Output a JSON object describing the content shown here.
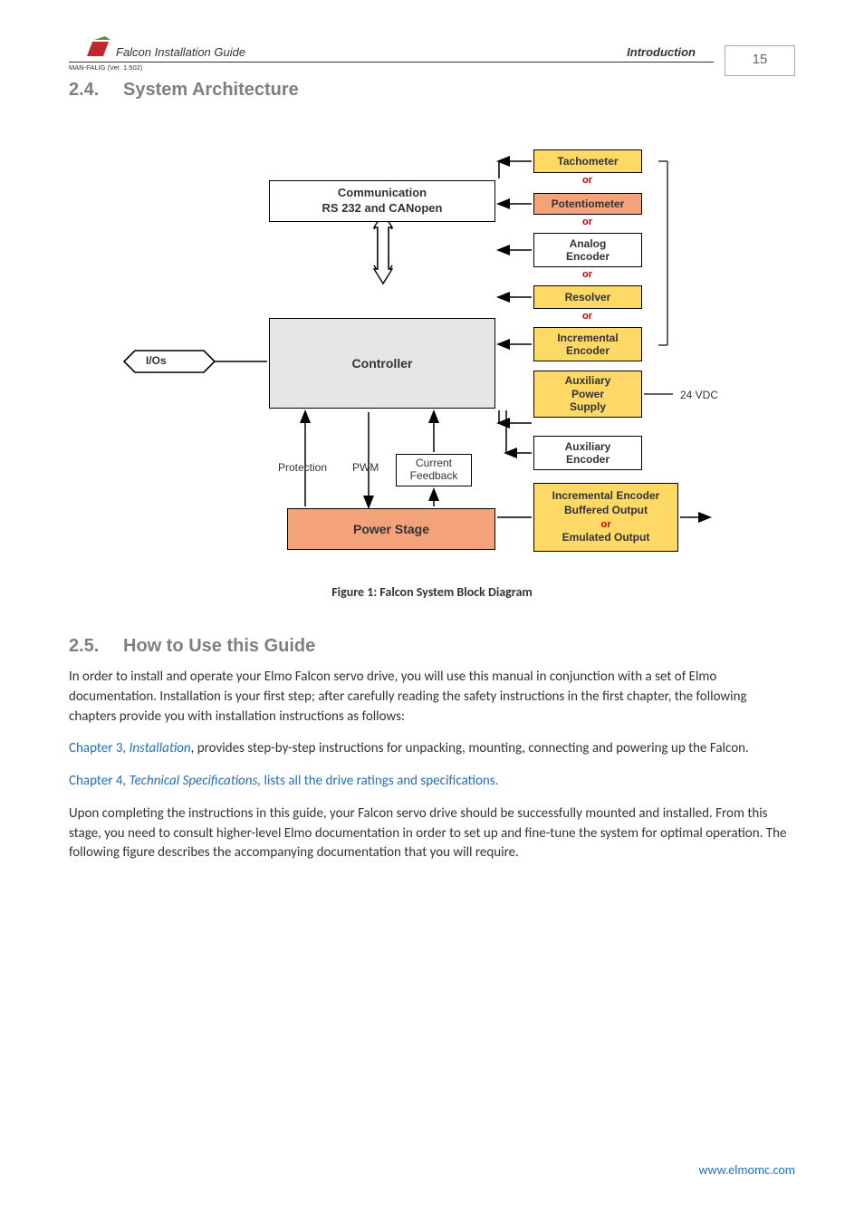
{
  "header": {
    "doc_title": "Falcon Installation Guide",
    "section_right": "Introduction",
    "version_line": "MAN-FALIG (Ver. 1.502)",
    "page_number": "15"
  },
  "section24": {
    "num": "2.4.",
    "title": "System Architecture"
  },
  "diagram": {
    "controller": "Controller",
    "power_stage": "Power Stage",
    "comm_l1": "Communication",
    "comm_l2": "RS 232 and CANopen",
    "ios": "I/Os",
    "current_l1": "Current",
    "current_l2": "Feedback",
    "protection": "Protection",
    "pwm": "PWM",
    "tacho": "Tachometer",
    "pot": "Potentiometer",
    "analog_l1": "Analog",
    "analog_l2": "Encoder",
    "resolver": "Resolver",
    "inc_l1": "Incremental",
    "inc_l2": "Encoder",
    "auxpw_l1": "Auxiliary",
    "auxpw_l2": "Power",
    "auxpw_l3": "Supply",
    "auxen_l1": "Auxiliary",
    "auxen_l2": "Encoder",
    "ibuf_l1": "Incremental Encoder",
    "ibuf_l2": "Buffered Output",
    "ibuf_or": "or",
    "ibuf_l3": "Emulated Output",
    "or": "or",
    "vdc": "24 VDC",
    "caption": "Figure 1: Falcon System Block Diagram"
  },
  "section25": {
    "num": "2.5.",
    "title": "How to Use this Guide"
  },
  "body": {
    "p1": "In order to install and operate your Elmo Falcon servo drive, you will use this manual in conjunction with a set of Elmo documentation. Installation is your first step; after carefully reading the safety instructions in the first chapter, the following chapters provide you with installation instructions as follows:",
    "p2a": "Chapter 3, ",
    "p2b": "Installation",
    "p2c": ", provides step-by-step instructions for unpacking, mounting, connecting and powering up the Falcon.",
    "p3a": "Chapter 4, ",
    "p3b": "Technical Specifications,",
    "p3c": " lists all the drive ratings and specifications.",
    "p4": "Upon completing the instructions in this guide, your Falcon servo drive should be successfully mounted and installed. From this stage, you need to consult higher-level Elmo documentation in order to set up and fine-tune the system for optimal operation. The following figure describes the accompanying documentation that you will require."
  },
  "footer": {
    "url": "www.elmomc.com"
  }
}
